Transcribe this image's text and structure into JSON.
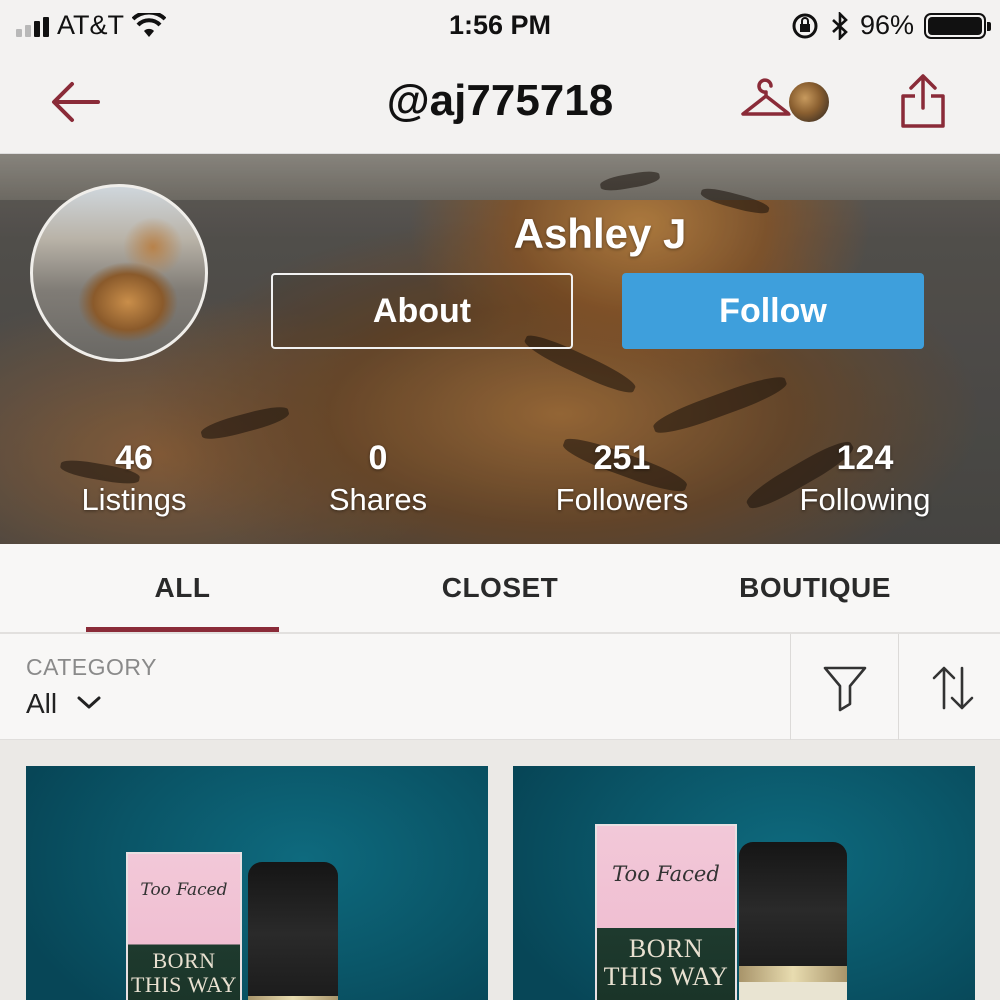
{
  "status_bar": {
    "carrier": "AT&T",
    "time": "1:56 PM",
    "battery": "96%",
    "battery_level": 0.96
  },
  "nav": {
    "title": "@aj775718",
    "icons": [
      "back-arrow-icon",
      "hanger-icon",
      "share-icon"
    ]
  },
  "profile": {
    "name": "Ashley J",
    "about_label": "About",
    "follow_label": "Follow",
    "follow_color": "#3e9fdc",
    "stats": [
      {
        "value": "46",
        "label": "Listings"
      },
      {
        "value": "0",
        "label": "Shares"
      },
      {
        "value": "251",
        "label": "Followers"
      },
      {
        "value": "124",
        "label": "Following"
      }
    ]
  },
  "tabs": [
    {
      "label": "ALL",
      "active": true
    },
    {
      "label": "CLOSET",
      "active": false
    },
    {
      "label": "BOUTIQUE",
      "active": false
    }
  ],
  "accent_color": "#8a2b38",
  "filter": {
    "category_label": "CATEGORY",
    "category_value": "All",
    "icons": [
      "filter-icon",
      "sort-icon"
    ]
  },
  "listings": [
    {
      "brand": "Too Faced",
      "line1": "BORN",
      "line2": "THIS WAY"
    },
    {
      "brand": "Too Faced",
      "line1": "BORN",
      "line2": "THIS WAY"
    }
  ]
}
